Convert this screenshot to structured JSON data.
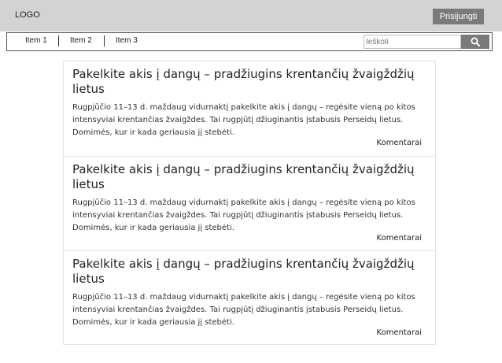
{
  "header": {
    "logo": "LOGO",
    "login_label": "Prisijungti"
  },
  "nav": {
    "items": [
      {
        "label": "Item 1"
      },
      {
        "label": "Item 2"
      },
      {
        "label": "Item 3"
      }
    ],
    "search": {
      "placeholder": "Ieškoti",
      "value": "",
      "button_icon": "search-icon"
    }
  },
  "articles": [
    {
      "title": "Pakelkite akis į dangų – pradžiugins krentančių žvaigždžių lietus",
      "body": "Rugpjūčio 11–13 d. maždaug vidurnaktį pakelkite akis į dangų – regėsite vieną po kitos intensyviai krentančias žvaigždes. Tai rugpjūtį džiuginantis įstabusis Perseidų lietus. Domimės, kur ir kada geriausia jį stebėti.",
      "comments_label": "Komentarai"
    },
    {
      "title": "Pakelkite akis į dangų – pradžiugins krentančių žvaigždžių lietus",
      "body": "Rugpjūčio 11–13 d. maždaug vidurnaktį pakelkite akis į dangų – regėsite vieną po kitos intensyviai krentančias žvaigždes. Tai rugpjūtį džiuginantis įstabusis Perseidų lietus. Domimės, kur ir kada geriausia jį stebėti.",
      "comments_label": "Komentarai"
    },
    {
      "title": "Pakelkite akis į dangų – pradžiugins krentančių žvaigždžių lietus",
      "body": "Rugpjūčio 11–13 d. maždaug vidurnaktį pakelkite akis į dangų – regėsite vieną po kitos intensyviai krentančias žvaigždes. Tai rugpjūtį džiuginantis įstabusis Perseidų lietus. Domimės, kur ir kada geriausia jį stebėti.",
      "comments_label": "Komentarai"
    }
  ]
}
